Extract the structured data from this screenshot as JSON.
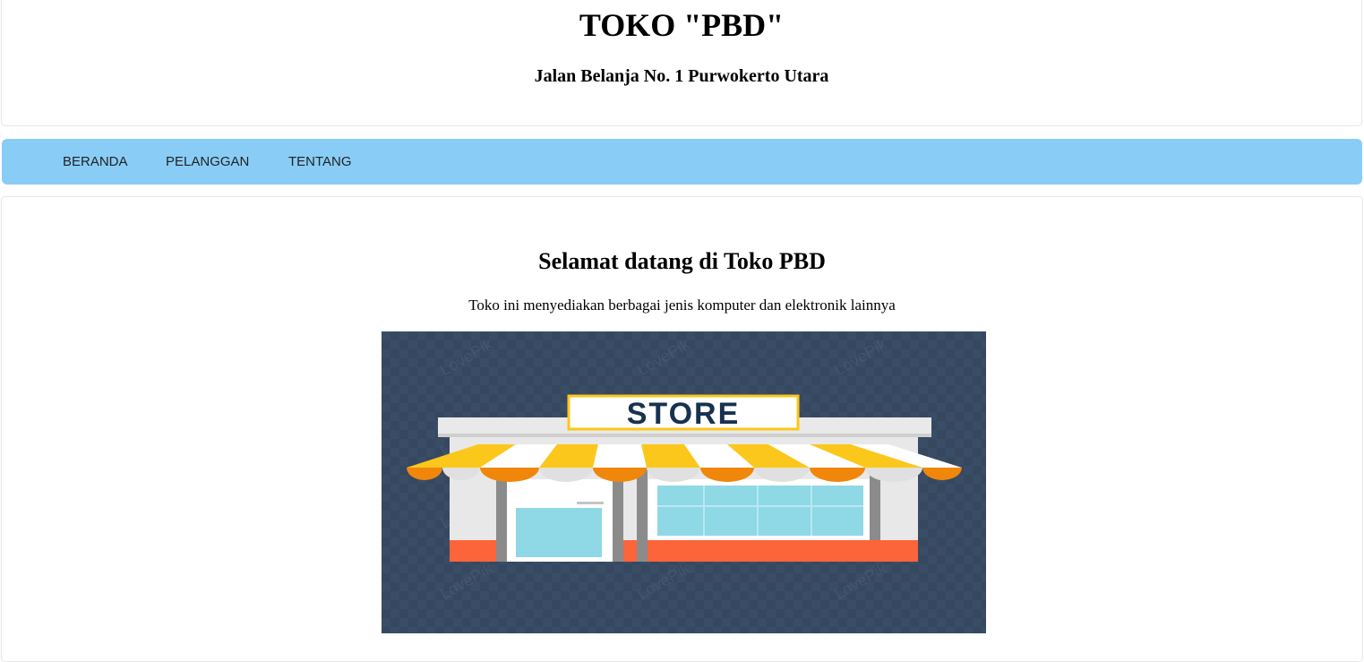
{
  "header": {
    "title": "TOKO \"PBD\"",
    "address": "Jalan Belanja No. 1 Purwokerto Utara"
  },
  "nav": {
    "items": [
      {
        "label": "BERANDA"
      },
      {
        "label": "PELANGGAN"
      },
      {
        "label": "TENTANG"
      }
    ]
  },
  "main": {
    "heading": "Selamat datang di Toko PBD",
    "description": "Toko ini menyediakan berbagai jenis komputer dan elektronik lainnya",
    "image": {
      "sign_text": "STORE",
      "watermark": "LovePik",
      "colors": {
        "background": "#364860",
        "awning_yellow": "#fbc71b",
        "awning_orange": "#f0870a",
        "glass": "#8fd8e6",
        "base": "#fc6439",
        "wall": "#e8e8e8",
        "pillar": "#8b8b8b",
        "sign_text": "#17324f"
      }
    }
  },
  "colors": {
    "navbar": "#89cdf7"
  }
}
